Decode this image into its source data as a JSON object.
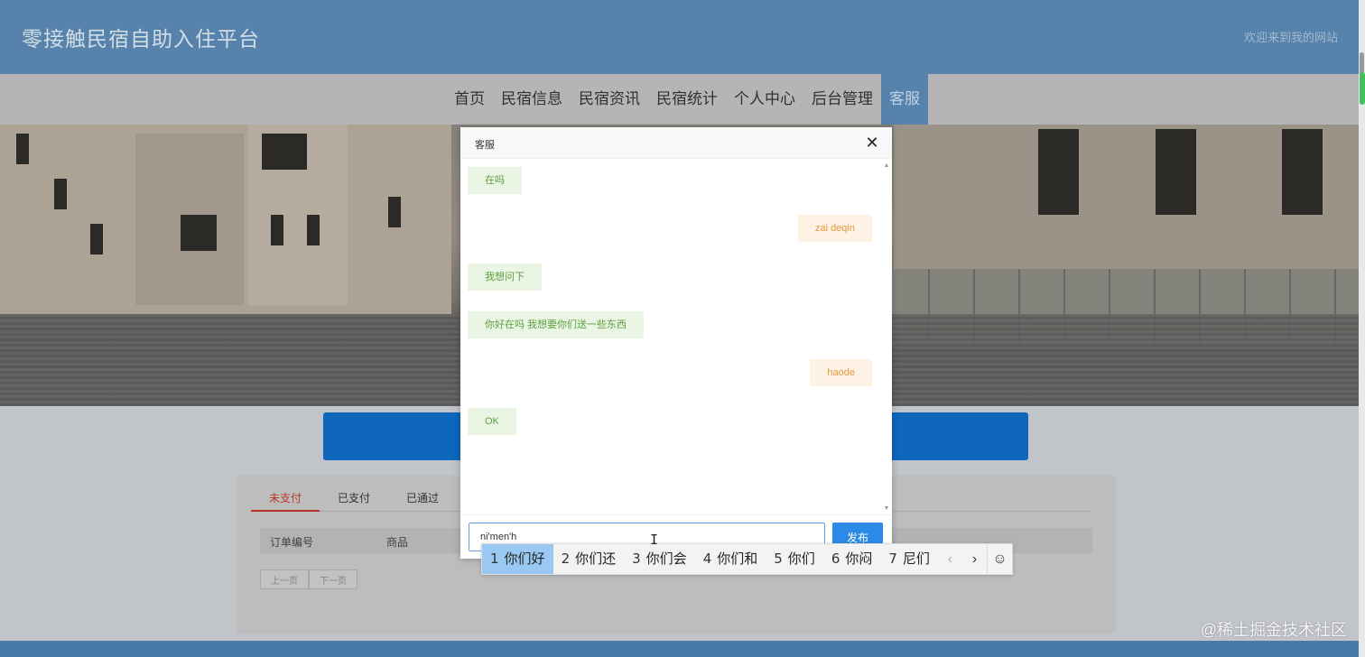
{
  "header": {
    "site_title": "零接触民宿自助入住平台",
    "welcome": "欢迎来到我的网站"
  },
  "nav": {
    "items": [
      "首页",
      "民宿信息",
      "民宿资讯",
      "民宿统计",
      "个人中心",
      "后台管理",
      "客服"
    ],
    "active": "客服"
  },
  "orders": {
    "tabs": [
      "未支付",
      "已支付",
      "已通过"
    ],
    "active_tab": "未支付",
    "columns": [
      "订单编号",
      "商品"
    ],
    "prev_label": "上一页",
    "next_label": "下一页"
  },
  "chat_dialog": {
    "title": "客服",
    "close_icon": "close-icon",
    "messages": [
      {
        "side": "in",
        "text": "在吗"
      },
      {
        "side": "out",
        "text": "zai deqin"
      },
      {
        "side": "in",
        "text": "我想问下"
      },
      {
        "side": "in",
        "text": "你好在吗 我想要你们送一些东西"
      },
      {
        "side": "out",
        "text": "haode"
      },
      {
        "side": "in",
        "text": "OK"
      }
    ],
    "input_value": "ni'men'h",
    "send_label": "发布"
  },
  "ime": {
    "candidates": [
      {
        "num": "1",
        "text": "你们好"
      },
      {
        "num": "2",
        "text": "你们还"
      },
      {
        "num": "3",
        "text": "你们会"
      },
      {
        "num": "4",
        "text": "你们和"
      },
      {
        "num": "5",
        "text": "你们"
      },
      {
        "num": "6",
        "text": "你闷"
      },
      {
        "num": "7",
        "text": "尼们"
      }
    ],
    "selected_index": 0,
    "prev_glyph": "‹",
    "next_glyph": "›",
    "emoji_glyph": "☺"
  },
  "watermark": "@稀土掘金技术社区",
  "colors": {
    "header_bg": "#5b88b2",
    "accent_blue": "#0f6bc5",
    "incoming_bubble": "#eaf5e4",
    "outgoing_bubble": "#fdf2e3",
    "send_button": "#2a8ae6"
  }
}
